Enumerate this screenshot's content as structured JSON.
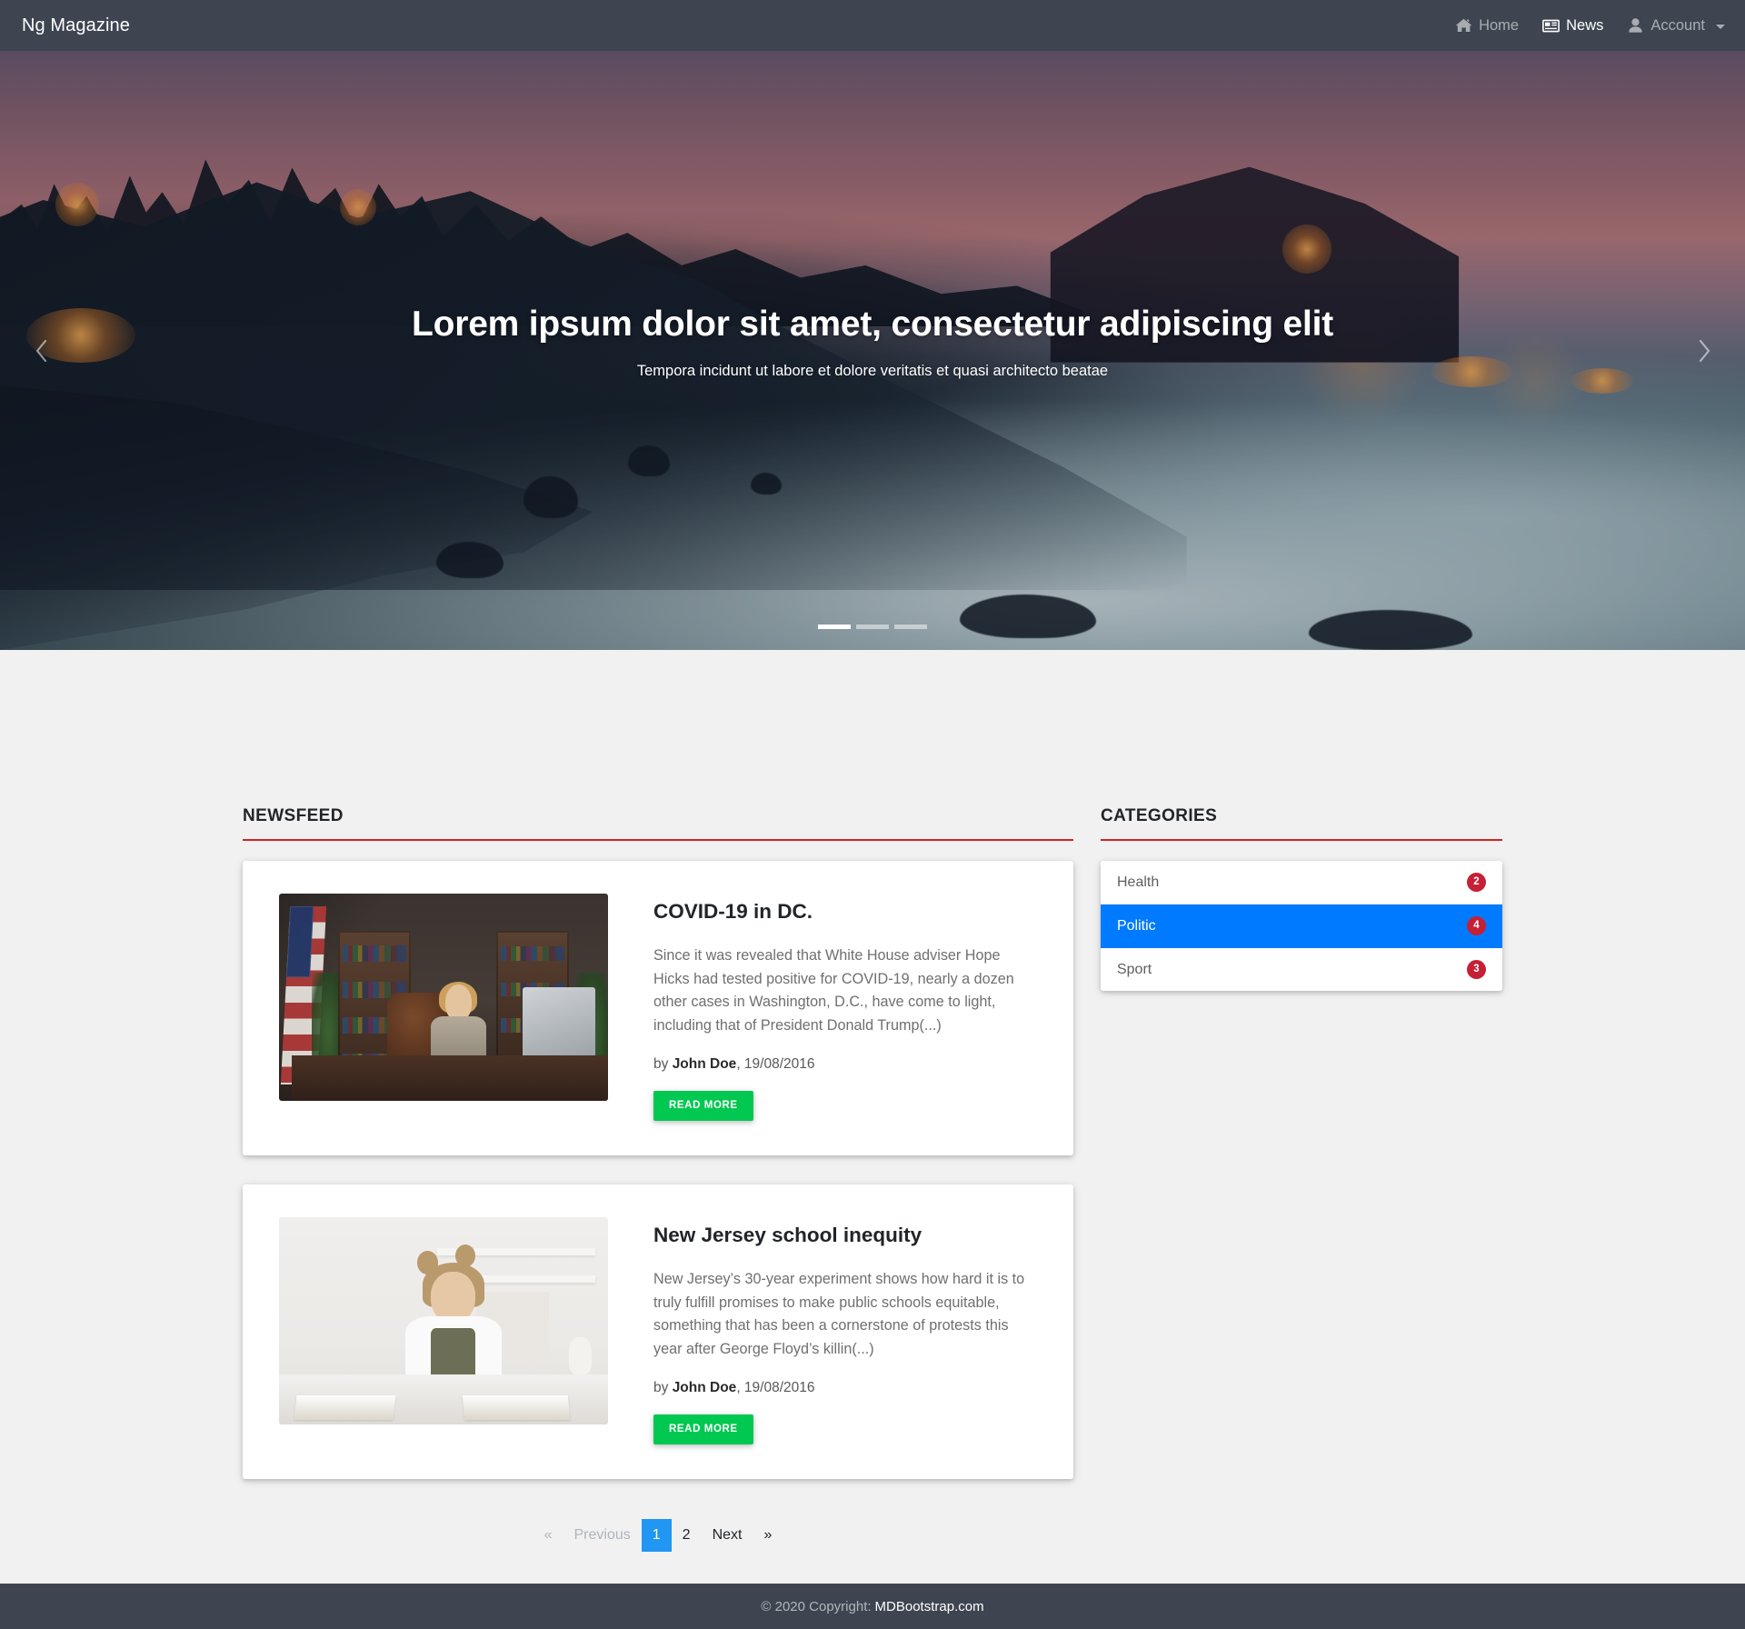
{
  "navbar": {
    "brand": "Ng Magazine",
    "links": [
      {
        "label": "Home",
        "icon": "home-icon",
        "active": false
      },
      {
        "label": "News",
        "icon": "newspaper-icon",
        "active": true
      },
      {
        "label": "Account",
        "icon": "user-icon",
        "active": false
      }
    ]
  },
  "hero": {
    "title": "Lorem ipsum dolor sit amet, consectetur adipiscing elit",
    "subtitle": "Tempora incidunt ut labore et dolore veritatis et quasi architecto beatae",
    "prev_icon": "chevron-left-icon",
    "next_icon": "chevron-right-icon",
    "slides": 3,
    "active_slide": 1
  },
  "newsfeed": {
    "heading": "NEWSFEED",
    "accent_color": "#d32323",
    "articles": [
      {
        "title": "COVID-19 in DC.",
        "excerpt": "Since it was revealed that White House adviser Hope Hicks had tested positive for COVID-19, nearly a dozen other cases in Washington, D.C., have come to light, including that of President Donald Trump(...)",
        "by_prefix": "by ",
        "author": "John Doe",
        "date": ", 19/08/2016",
        "button_label": "Read more",
        "image_alt": "woman-at-desk-in-office"
      },
      {
        "title": "New Jersey school inequity",
        "excerpt": "New Jersey’s 30-year experiment shows how hard it is to truly fulfill promises to make public schools equitable, something that has been a cornerstone of protests this year after George Floyd’s killin(...)",
        "by_prefix": "by ",
        "author": "John Doe",
        "date": ", 19/08/2016",
        "button_label": "Read more",
        "image_alt": "girl-studying-at-table"
      }
    ]
  },
  "pagination": {
    "first_symbol": "«",
    "previous_label": "Previous",
    "pages": [
      "1",
      "2"
    ],
    "active_page": "1",
    "next_label": "Next",
    "last_symbol": "»"
  },
  "categories": {
    "heading": "CATEGORIES",
    "accent_color": "#d32323",
    "items": [
      {
        "label": "Health",
        "count": "2",
        "active": false
      },
      {
        "label": "Politic",
        "count": "4",
        "active": true
      },
      {
        "label": "Sport",
        "count": "3",
        "active": false
      }
    ],
    "active_color": "#007bff",
    "badge_color": "#c62036"
  },
  "footer": {
    "copyright": "© 2020 Copyright:",
    "link": "MDBootstrap.com"
  }
}
